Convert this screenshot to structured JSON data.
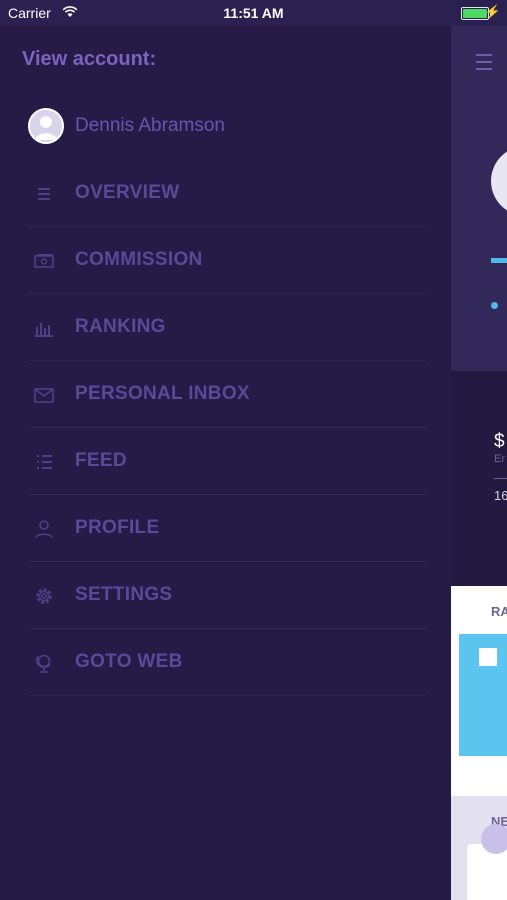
{
  "status_bar": {
    "carrier": "Carrier",
    "time": "11:51 AM"
  },
  "menu": {
    "heading": "View account:",
    "account_name": "Dennis Abramson",
    "items": [
      {
        "label": "OVERVIEW",
        "icon": "list-icon"
      },
      {
        "label": "COMMISSION",
        "icon": "money-icon"
      },
      {
        "label": "RANKING",
        "icon": "bar-chart-icon"
      },
      {
        "label": "PERSONAL INBOX",
        "icon": "envelope-icon"
      },
      {
        "label": "FEED",
        "icon": "bullet-list-icon"
      },
      {
        "label": "PROFILE",
        "icon": "person-icon"
      },
      {
        "label": "SETTINGS",
        "icon": "gear-icon"
      },
      {
        "label": "GOTO WEB",
        "icon": "globe-icon"
      }
    ]
  },
  "peek": {
    "dollar": "$",
    "sub": "Er",
    "number": "16",
    "card_title": "RA",
    "news_title": "NE"
  },
  "colors": {
    "background": "#261b47",
    "accent": "#7b63c0",
    "highlight": "#4fb8ec"
  }
}
